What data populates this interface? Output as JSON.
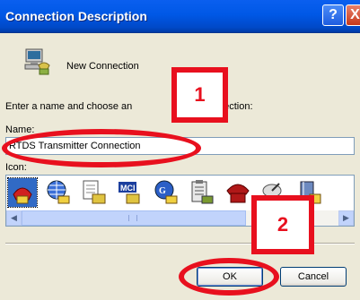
{
  "window": {
    "title": "Connection Description",
    "help_glyph": "?",
    "close_glyph": "X"
  },
  "header": {
    "connection_label": "New Connection"
  },
  "form": {
    "prompt": "Enter a name and choose an",
    "prompt_suffix": "connection:",
    "name_label": "Name:",
    "name_value": "RTDS Transmitter Connection",
    "icon_label": "Icon:"
  },
  "icons": [
    {
      "name": "phone-red-icon",
      "selected": true
    },
    {
      "name": "globe-phone-icon",
      "selected": false
    },
    {
      "name": "document-phone-icon",
      "selected": false
    },
    {
      "name": "mci-phone-icon",
      "selected": false
    },
    {
      "name": "ge-phone-icon",
      "selected": false
    },
    {
      "name": "clipboard-phone-icon",
      "selected": false
    },
    {
      "name": "telephone-icon",
      "selected": false
    },
    {
      "name": "satellite-dish-icon",
      "selected": false
    },
    {
      "name": "phone-book-icon",
      "selected": false
    }
  ],
  "buttons": {
    "ok": "OK",
    "cancel": "Cancel"
  },
  "annotations": {
    "step1": "1",
    "step2": "2",
    "color": "#E8101E"
  }
}
